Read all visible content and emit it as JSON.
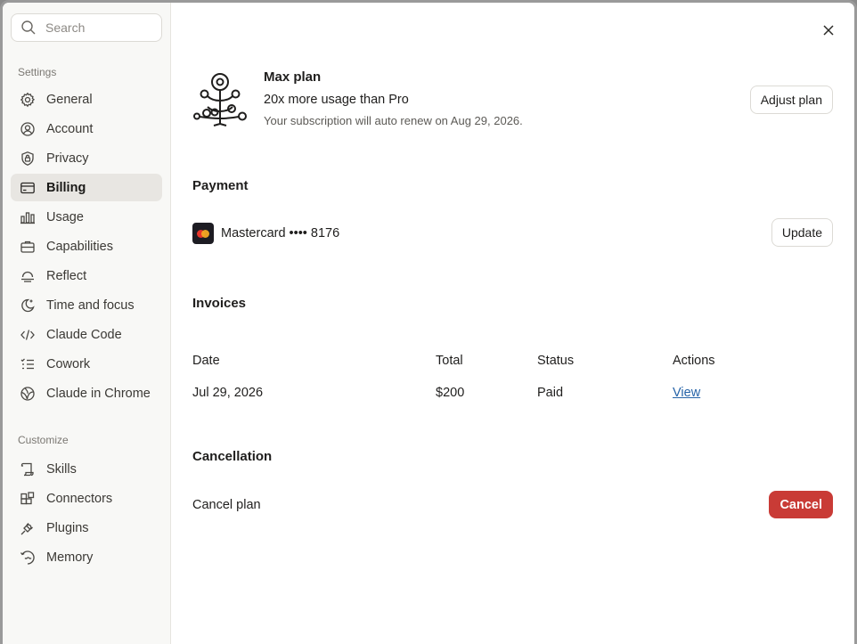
{
  "search": {
    "placeholder": "Search"
  },
  "sidebar": {
    "settings_label": "Settings",
    "settings_items": [
      {
        "label": "General",
        "icon": "gear-icon"
      },
      {
        "label": "Account",
        "icon": "user-circle-icon"
      },
      {
        "label": "Privacy",
        "icon": "shield-lock-icon"
      },
      {
        "label": "Billing",
        "icon": "credit-card-icon",
        "active": true
      },
      {
        "label": "Usage",
        "icon": "bar-chart-icon"
      },
      {
        "label": "Capabilities",
        "icon": "briefcase-icon"
      },
      {
        "label": "Reflect",
        "icon": "reflect-icon"
      },
      {
        "label": "Time and focus",
        "icon": "moon-icon"
      },
      {
        "label": "Claude Code",
        "icon": "code-icon"
      },
      {
        "label": "Cowork",
        "icon": "checklist-icon"
      },
      {
        "label": "Claude in Chrome",
        "icon": "globe-icon"
      }
    ],
    "customize_label": "Customize",
    "customize_items": [
      {
        "label": "Skills",
        "icon": "scroll-icon"
      },
      {
        "label": "Connectors",
        "icon": "blocks-icon"
      },
      {
        "label": "Plugins",
        "icon": "plug-icon"
      },
      {
        "label": "Memory",
        "icon": "memory-icon"
      }
    ]
  },
  "plan": {
    "title": "Max plan",
    "subtitle": "20x more usage than Pro",
    "renew": "Your subscription will auto renew on Aug 29, 2026.",
    "adjust_label": "Adjust plan"
  },
  "payment": {
    "title": "Payment",
    "card": "Mastercard •••• 8176",
    "update_label": "Update"
  },
  "invoices": {
    "title": "Invoices",
    "columns": [
      "Date",
      "Total",
      "Status",
      "Actions"
    ],
    "rows": [
      {
        "date": "Jul 29, 2026",
        "total": "$200",
        "status": "Paid",
        "action": "View"
      }
    ]
  },
  "cancellation": {
    "title": "Cancellation",
    "label": "Cancel plan",
    "button": "Cancel"
  },
  "colors": {
    "accent_danger": "#c93b36",
    "link": "#2563a8",
    "active_bg": "#e8e6e2"
  }
}
